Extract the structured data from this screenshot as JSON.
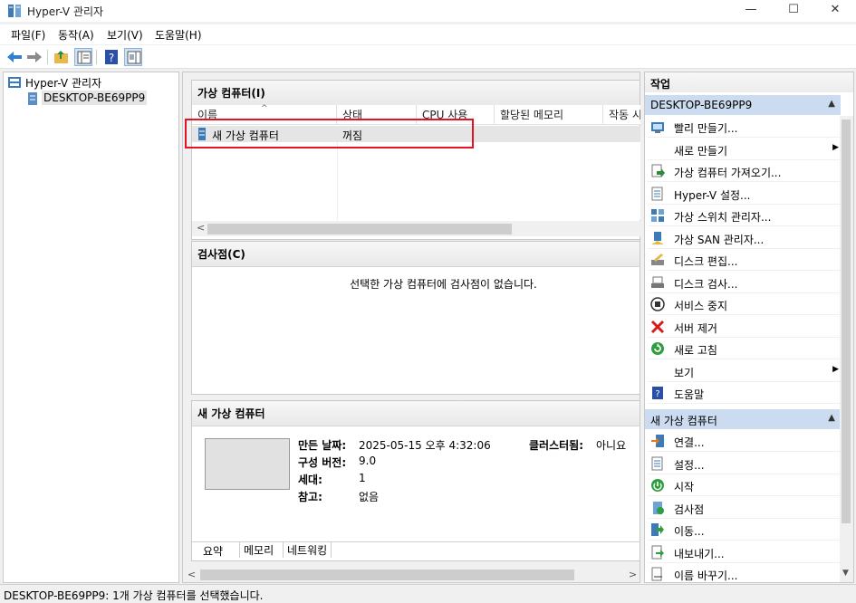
{
  "window": {
    "title": "Hyper-V 관리자",
    "minimize": "—",
    "maximize": "☐",
    "close": "✕"
  },
  "menu": [
    "파일(F)",
    "동작(A)",
    "보기(V)",
    "도움말(H)"
  ],
  "tree": {
    "root": "Hyper-V 관리자",
    "child": "DESKTOP-BE69PP9"
  },
  "vm_section": {
    "title": "가상 컴퓨터(I)",
    "columns": [
      "이름",
      "상태",
      "CPU 사용",
      "할당된 메모리",
      "작동 시"
    ],
    "rows": [
      {
        "name": "새 가상 컴퓨터",
        "state": "꺼짐"
      }
    ]
  },
  "checkpoint_section": {
    "title": "검사점(C)",
    "empty_message": "선택한 가상 컴퓨터에 검사점이 없습니다."
  },
  "detail_section": {
    "title": "새 가상 컴퓨터",
    "created_label": "만든 날짜:",
    "created_value": "2025-05-15 오후 4:32:06",
    "cluster_label": "클러스터됨:",
    "cluster_value": "아니요",
    "version_label": "구성 버전:",
    "version_value": "9.0",
    "generation_label": "세대:",
    "generation_value": "1",
    "notes_label": "참고:",
    "notes_value": "없음",
    "tabs": [
      "요약",
      "메모리",
      "네트워킹"
    ]
  },
  "actions": {
    "title": "작업",
    "host_header": "DESKTOP-BE69PP9",
    "host_items": [
      {
        "label": "빨리 만들기...",
        "icon": "quick-create-icon",
        "submenu": false
      },
      {
        "label": "새로 만들기",
        "icon": "none",
        "submenu": true
      },
      {
        "label": "가상 컴퓨터 가져오기...",
        "icon": "import-icon",
        "submenu": false
      },
      {
        "label": "Hyper-V 설정...",
        "icon": "settings-icon",
        "submenu": false
      },
      {
        "label": "가상 스위치 관리자...",
        "icon": "switch-icon",
        "submenu": false
      },
      {
        "label": "가상 SAN 관리자...",
        "icon": "san-icon",
        "submenu": false
      },
      {
        "label": "디스크 편집...",
        "icon": "disk-edit-icon",
        "submenu": false
      },
      {
        "label": "디스크 검사...",
        "icon": "disk-inspect-icon",
        "submenu": false
      },
      {
        "label": "서비스 중지",
        "icon": "stop-icon",
        "submenu": false
      },
      {
        "label": "서버 제거",
        "icon": "remove-icon",
        "submenu": false
      },
      {
        "label": "새로 고침",
        "icon": "refresh-icon",
        "submenu": false
      },
      {
        "label": "보기",
        "icon": "none",
        "submenu": true
      },
      {
        "label": "도움말",
        "icon": "help-icon",
        "submenu": false
      }
    ],
    "vm_header": "새 가상 컴퓨터",
    "vm_items": [
      {
        "label": "연결...",
        "icon": "connect-icon"
      },
      {
        "label": "설정...",
        "icon": "settings-icon"
      },
      {
        "label": "시작",
        "icon": "start-icon"
      },
      {
        "label": "검사점",
        "icon": "checkpoint-icon"
      },
      {
        "label": "이동...",
        "icon": "move-icon"
      },
      {
        "label": "내보내기...",
        "icon": "export-icon"
      },
      {
        "label": "이름 바꾸기...",
        "icon": "rename-icon"
      }
    ]
  },
  "status": "DESKTOP-BE69PP9:  1개 가상 컴퓨터를 선택했습니다.",
  "colors": {
    "accent": "#cbdbf0",
    "highlight": "#e81123",
    "selection": "#e5e5e5"
  }
}
